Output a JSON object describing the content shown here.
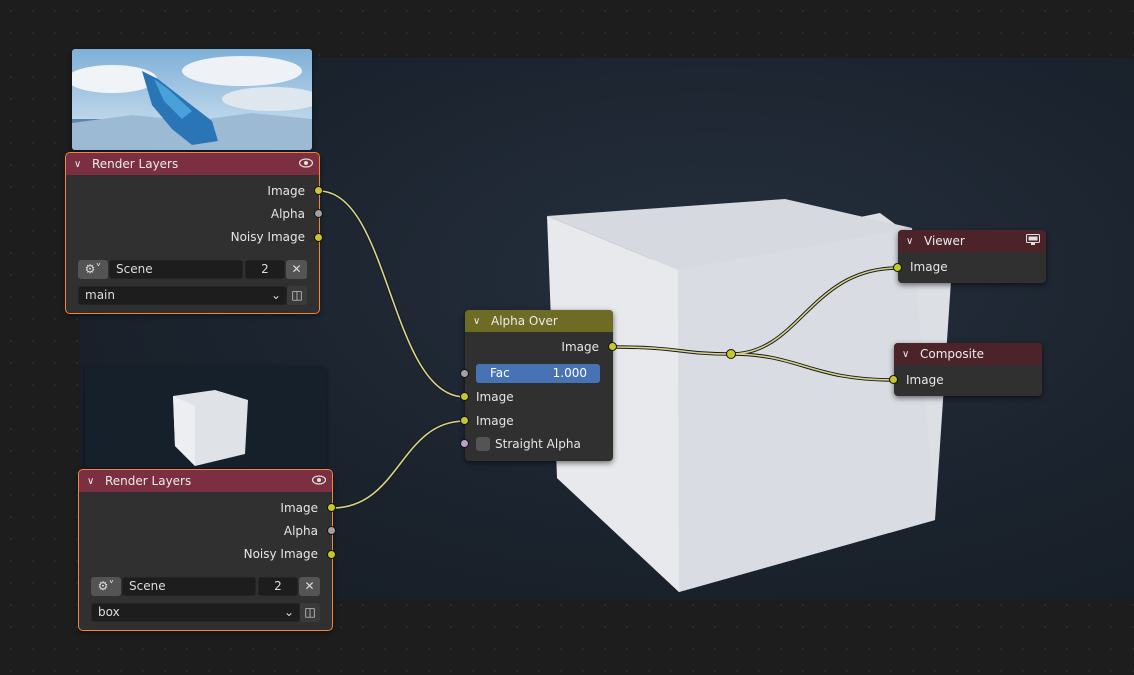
{
  "nodes": {
    "render_layers_1": {
      "title": "Render Layers",
      "outputs": {
        "image": "Image",
        "alpha": "Alpha",
        "noisy_image": "Noisy Image"
      },
      "scene": {
        "name": "Scene",
        "users": "2"
      },
      "view_layer": "main"
    },
    "render_layers_2": {
      "title": "Render Layers",
      "outputs": {
        "image": "Image",
        "alpha": "Alpha",
        "noisy_image": "Noisy Image"
      },
      "scene": {
        "name": "Scene",
        "users": "2"
      },
      "view_layer": "box"
    },
    "alpha_over": {
      "title": "Alpha Over",
      "output_image": "Image",
      "fac_label": "Fac",
      "fac_value": "1.000",
      "input_image_1": "Image",
      "input_image_2": "Image",
      "straight_alpha_label": "Straight Alpha",
      "straight_alpha_checked": false
    },
    "viewer": {
      "title": "Viewer",
      "input_image": "Image"
    },
    "composite": {
      "title": "Composite",
      "input_image": "Image"
    }
  },
  "icons": {
    "visibility": "eye-icon",
    "collapse": "chevron-down-icon",
    "scene_browse": "scene-icon",
    "clear": "close-icon",
    "monitor": "monitor-icon",
    "layer_browse": "layers-icon"
  },
  "colors": {
    "render_layer_header": "#7b2f41",
    "alpha_over_header": "#6e6b25",
    "output_header": "#4b2329",
    "selected_outline": "#f3863a",
    "image_socket": "#c7c729",
    "float_socket": "#a1a1a1",
    "boolean_socket": "#b9a0d0",
    "wire": "#d6d38a",
    "slider": "#4772b3"
  }
}
